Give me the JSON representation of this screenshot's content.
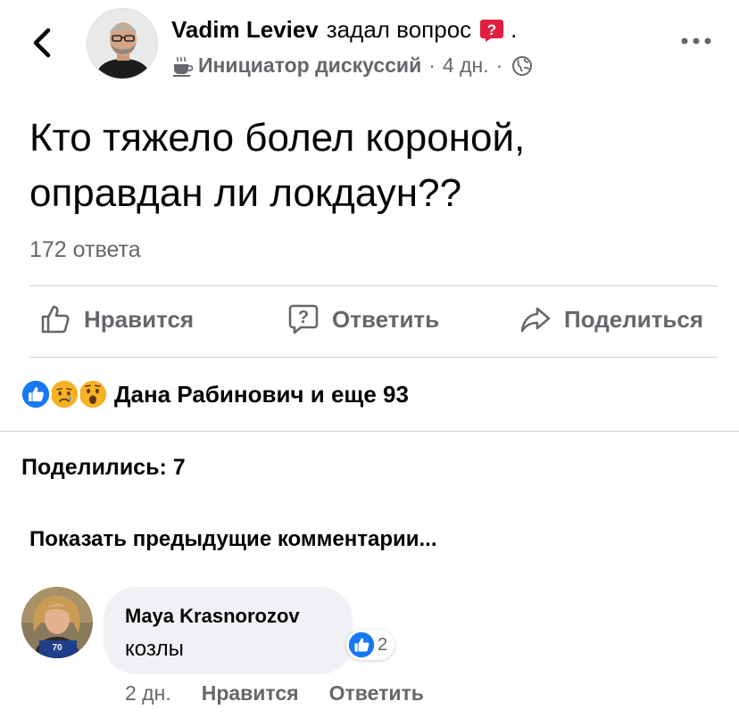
{
  "post": {
    "author_name": "Vadim Leviev",
    "asked_text": "задал вопрос",
    "trailing_dot": ".",
    "badge_label": "Инициатор дискуссий",
    "separator": "·",
    "time": "4 дн.",
    "privacy_icon": "globe-icon",
    "question_line1": "Кто тяжело болел короной,",
    "question_line2": "оправдан ли локдаун??",
    "answers_count": "172 ответа"
  },
  "actions": {
    "like": "Нравится",
    "answer": "Ответить",
    "share": "Поделиться"
  },
  "reactions": {
    "icons": [
      "like-icon",
      "sad-icon",
      "wow-icon"
    ],
    "text": "Дана Рабинович и еще 93"
  },
  "shares_text": "Поделились: 7",
  "prev_comments": "Показать предыдущие комментарии...",
  "comment": {
    "author": "Maya Krasnorozov",
    "text": "козлы",
    "reaction_count": "2",
    "time": "2 дн.",
    "like": "Нравится",
    "reply": "Ответить"
  },
  "colors": {
    "accent": "#1877f2",
    "secondary_text": "#65676b",
    "bubble": "#f0f2f5",
    "badge_red": "#e41e3f"
  }
}
